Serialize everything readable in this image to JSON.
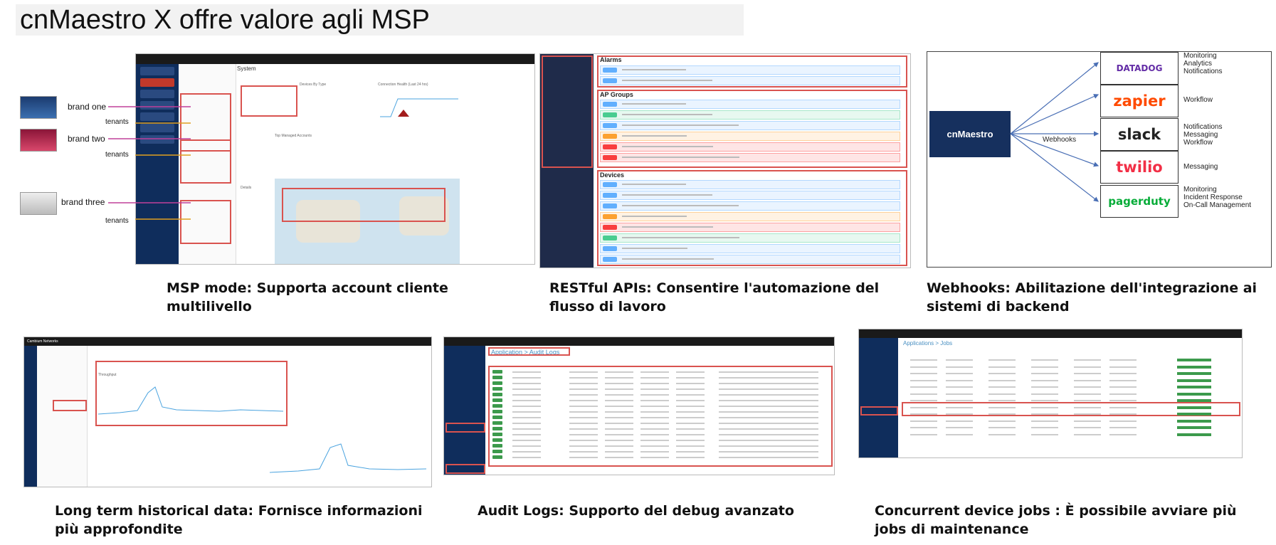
{
  "slide": {
    "title": "cnMaestro X offre valore agli MSP"
  },
  "captions": {
    "msp": "MSP mode: Supporta account cliente multilivello",
    "restful": "RESTful APIs: Consentire l'automazione del flusso di lavoro",
    "webhooks": "Webhooks: Abilitazione dell'integrazione ai sistemi di backend",
    "historical": "Long term historical data: Fornisce informazioni più approfondite",
    "audit": "Audit Logs: Supporto del debug avanzato",
    "jobs": "Concurrent device jobs : È possibile avviare più jobs di maintenance"
  },
  "msp_panel": {
    "brands": [
      "brand one",
      "brand two",
      "brand three"
    ],
    "tenants_label": "tenants",
    "section_title": "System",
    "chart_title": "Connection Health (Last 24 hrs)",
    "devices_title": "Devices By Type",
    "managed_title": "Top Managed Accounts",
    "details_title": "Details"
  },
  "api_panel": {
    "sections": [
      {
        "title": "Alarms",
        "subtitle": "Alarms related APIs",
        "methods": [
          "GET",
          "GET"
        ]
      },
      {
        "title": "AP Groups",
        "subtitle": "cnPilot Enterprise AP Group related APIs",
        "methods": [
          "GET",
          "POST",
          "GET",
          "PUT",
          "DELETE",
          "DELETE"
        ]
      },
      {
        "title": "Devices",
        "subtitle": "Device related APIs",
        "methods": [
          "GET",
          "GET",
          "GET",
          "PUT",
          "DELETE",
          "POST",
          "GET",
          "GET"
        ]
      }
    ],
    "method_colors": {
      "GET": "#61affe",
      "POST": "#49cc90",
      "PUT": "#fca130",
      "DELETE": "#f93e3e"
    }
  },
  "webhooks_panel": {
    "source": "cnMaestro",
    "edge_label": "Webhooks",
    "targets": [
      {
        "name": "DATADOG",
        "icon": "datadog-icon",
        "color": "#632ca6",
        "desc": [
          "Monitoring",
          "Analytics",
          "Notifications"
        ]
      },
      {
        "name": "zapier",
        "icon": "zapier-icon",
        "color": "#ff4a00",
        "desc": [
          "Workflow"
        ]
      },
      {
        "name": "slack",
        "icon": "slack-icon",
        "color": "#222222",
        "desc": [
          "Notifications",
          "Messaging",
          "Workflow"
        ]
      },
      {
        "name": "twilio",
        "icon": "twilio-icon",
        "color": "#f22f46",
        "desc": [
          "Messaging"
        ]
      },
      {
        "name": "pagerduty",
        "icon": "pagerduty-icon",
        "color": "#06ac38",
        "desc": [
          "Monitoring",
          "Incident Response",
          "On-Call Management"
        ]
      }
    ]
  },
  "historical_panel": {
    "app_name": "Cambium Networks",
    "chart_title": "Throughput"
  },
  "audit_panel": {
    "breadcrumb": "Application > Audit Logs"
  },
  "jobs_panel": {
    "breadcrumb": "Applications > Jobs"
  }
}
